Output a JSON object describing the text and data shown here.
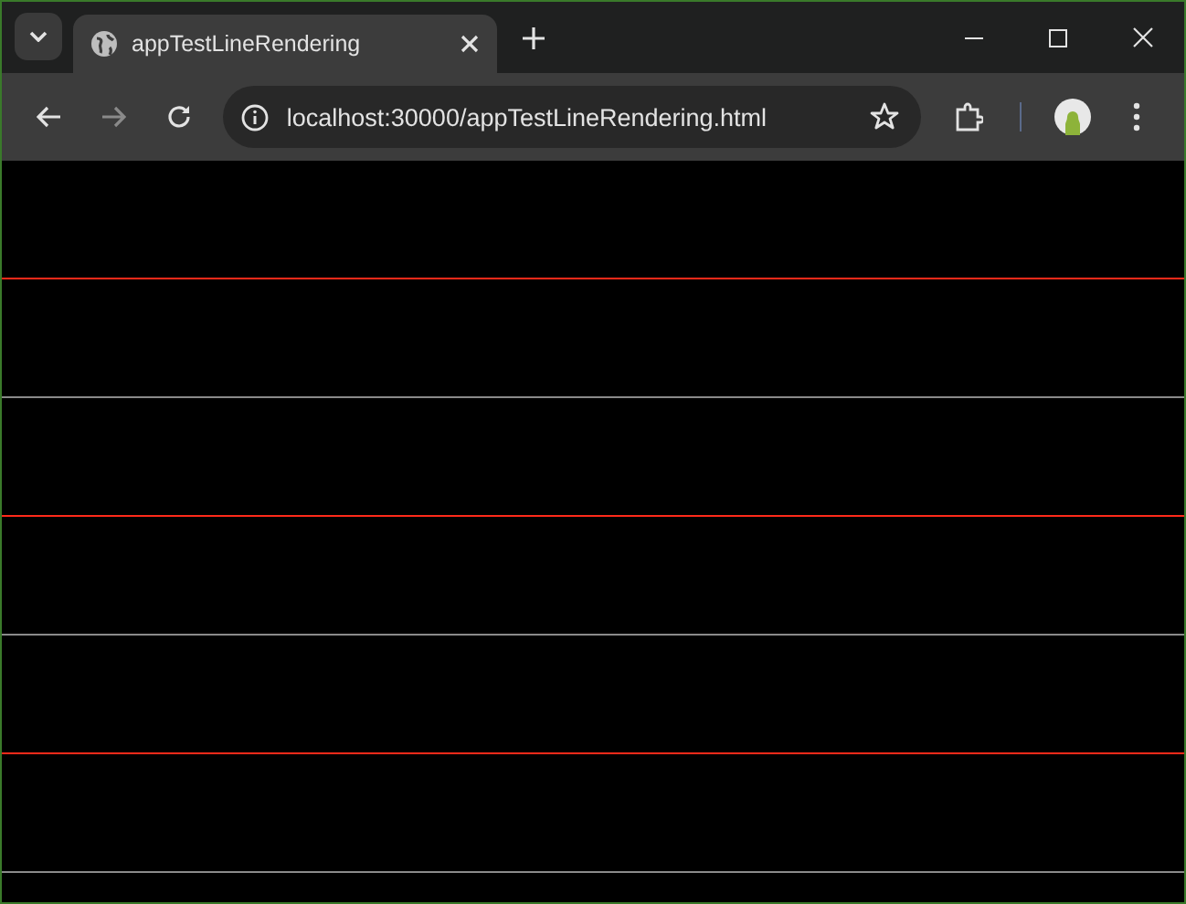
{
  "tab": {
    "title": "appTestLineRendering"
  },
  "address_bar": {
    "url": "localhost:30000/appTestLineRendering.html"
  },
  "lines": [
    {
      "color": "#ff2a1a"
    },
    {
      "color": "#8a8a8a"
    },
    {
      "color": "#ff2a1a"
    },
    {
      "color": "#8a8a8a"
    },
    {
      "color": "#ff2a1a"
    },
    {
      "color": "#8a8a8a"
    }
  ]
}
